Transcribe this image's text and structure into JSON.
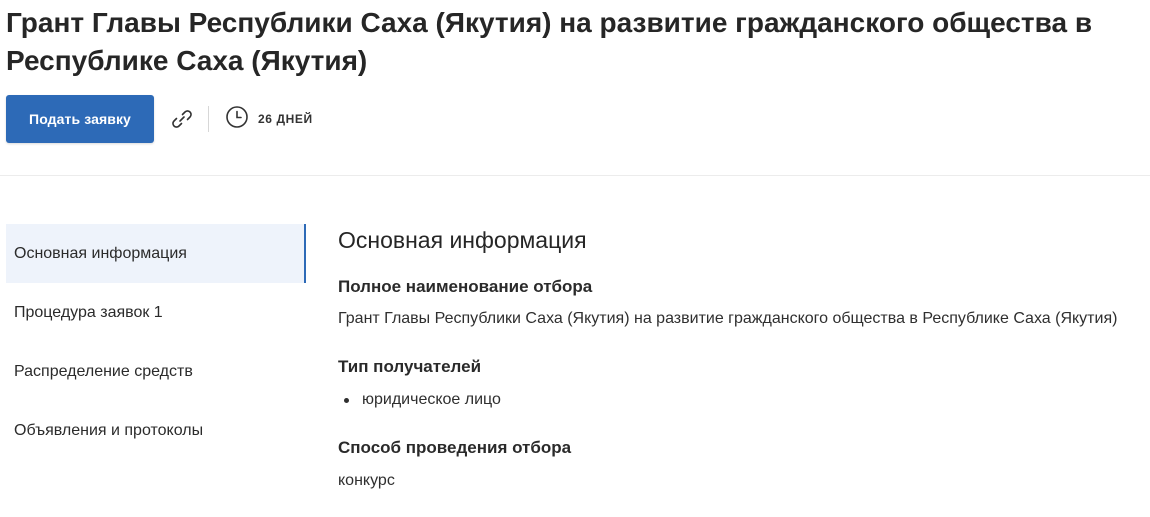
{
  "page": {
    "title": "Грант Главы Республики Саха (Якутия) на развитие гражданского общества в Республике Саха (Якутия)"
  },
  "actions": {
    "apply_label": "Подать заявку",
    "link_icon": "link-icon",
    "clock_icon": "clock-icon",
    "deadline_text": "26 ДНЕЙ"
  },
  "colors": {
    "accent": "#2d6ab7",
    "active_nav_bg": "#eef3fb"
  },
  "sidebar": {
    "items": [
      {
        "label": "Основная информация",
        "active": true
      },
      {
        "label": "Процедура заявок 1",
        "active": false
      },
      {
        "label": "Распределение средств",
        "active": false
      },
      {
        "label": "Объявления и протоколы",
        "active": false
      }
    ]
  },
  "main": {
    "section_title": "Основная информация",
    "fields": [
      {
        "label": "Полное наименование отбора",
        "value": "Грант Главы Республики Саха (Якутия) на развитие гражданского общества в Республике Саха (Якутия)"
      },
      {
        "label": "Тип получателей",
        "items": [
          "юридическое лицо"
        ]
      },
      {
        "label": "Способ проведения отбора",
        "value": "конкурс"
      }
    ]
  }
}
